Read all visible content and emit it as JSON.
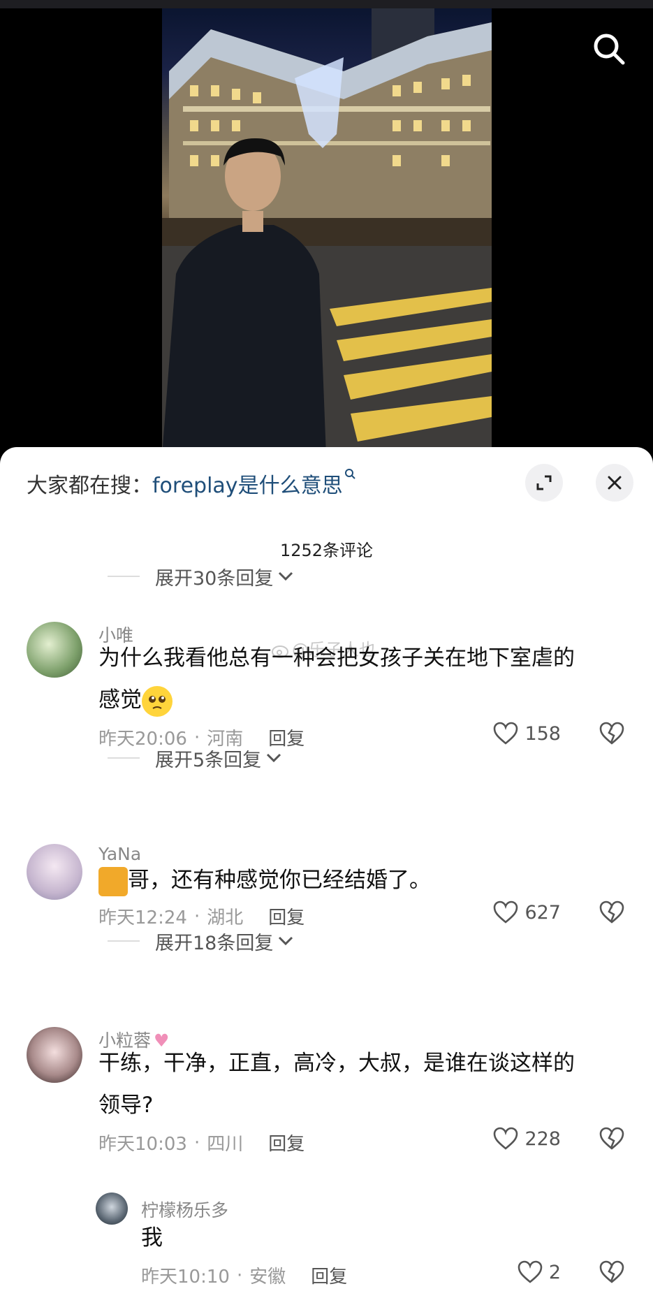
{
  "header": {
    "search_icon": "search-icon"
  },
  "sheet": {
    "hot_search_prefix": "大家都在搜：",
    "hot_search_keyword": "foreplay是什么意思",
    "comment_count": "1252条评论",
    "expand_top": "展开30条回复"
  },
  "comments": [
    {
      "user": "小唯",
      "text_line1": "为什么我看他总有一种会把女孩子关在地下室虐的",
      "text_line2": "感觉",
      "time": "昨天20:06",
      "location": "河南",
      "reply": "回复",
      "likes": "158",
      "expand": "展开5条回复"
    },
    {
      "user": "YaNa",
      "text": "哥，还有种感觉你已经结婚了。",
      "time": "昨天12:24",
      "location": "湖北",
      "reply": "回复",
      "likes": "627",
      "expand": "展开18条回复"
    },
    {
      "user": "小粒蓉",
      "text_line1": "干练，干净，正直，高冷，大叔，是谁在谈这样的",
      "text_line2": "领导?",
      "time": "昨天10:03",
      "location": "四川",
      "reply": "回复",
      "likes": "228"
    }
  ],
  "subreply": {
    "user": "柠檬杨乐多",
    "text": "我",
    "time": "昨天10:10",
    "location": "安徽",
    "reply": "回复",
    "likes": "2"
  },
  "watermark": "@乐子人也",
  "colors": {
    "keyword": "#1f4e79",
    "meta": "#999999"
  }
}
